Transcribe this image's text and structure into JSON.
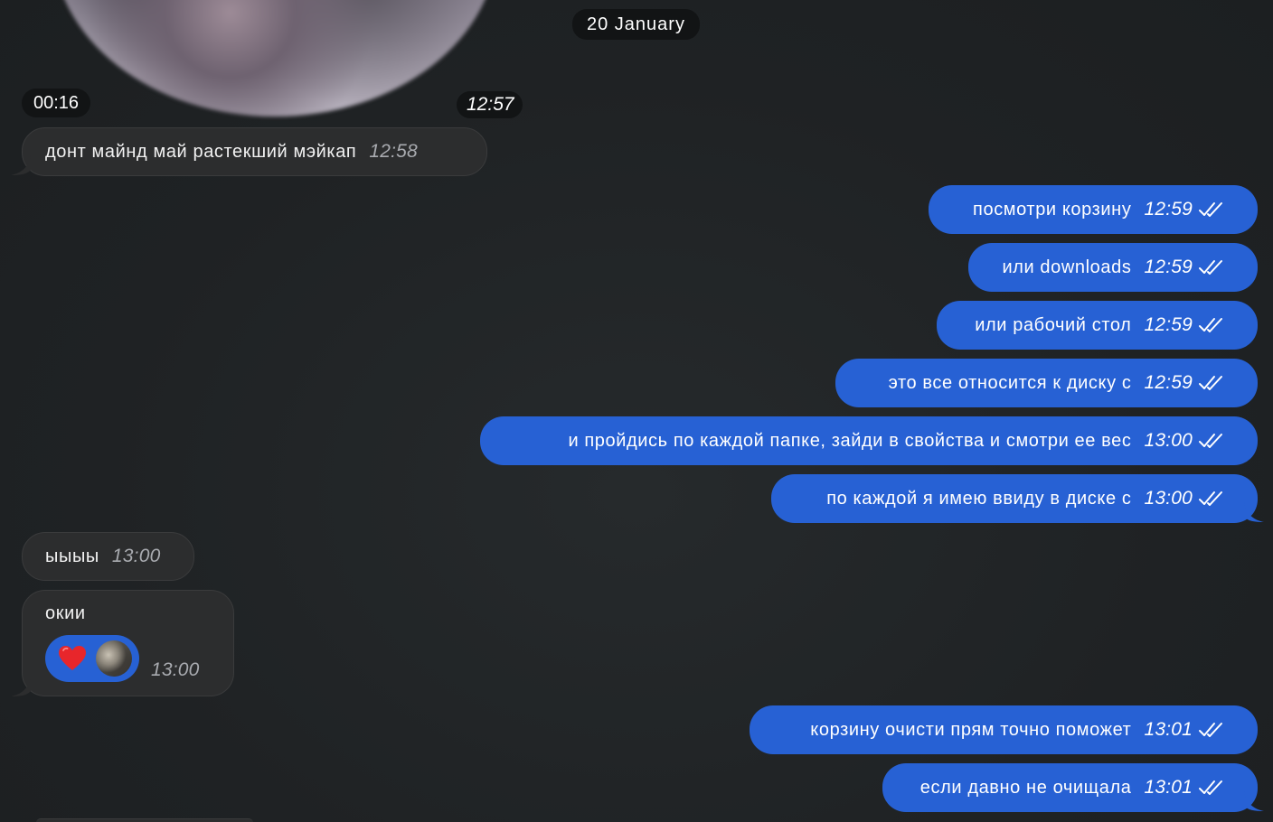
{
  "date_separator": "20 January",
  "video_message": {
    "duration": "00:16",
    "time": "12:57"
  },
  "messages_in": [
    {
      "text": "донт майнд май растекший мэйкап",
      "time": "12:58"
    },
    {
      "text": "ыыыы",
      "time": "13:00"
    },
    {
      "text": "окии",
      "time": "13:00",
      "reaction": "heart-emoji"
    }
  ],
  "messages_out": [
    {
      "text": "посмотри корзину",
      "time": "12:59",
      "status": "read"
    },
    {
      "text": "или downloads",
      "time": "12:59",
      "status": "read"
    },
    {
      "text": "или рабочий стол",
      "time": "12:59",
      "status": "read"
    },
    {
      "text": "это все относится к диску с",
      "time": "12:59",
      "status": "read"
    },
    {
      "text": "и пройдись по каждой папке, зайди в свойства и смотри ее вес",
      "time": "13:00",
      "status": "read"
    },
    {
      "text": "по каждой я имею ввиду в диске с",
      "time": "13:00",
      "status": "read"
    },
    {
      "text": "корзину очисти прям точно поможет",
      "time": "13:01",
      "status": "read"
    },
    {
      "text": "если давно не очищала",
      "time": "13:01",
      "status": "read"
    }
  ],
  "colors": {
    "background": "#1f2224",
    "incoming_bubble": "#2c2d2e",
    "outgoing_bubble": "#2761d4",
    "pill": "#121415"
  }
}
